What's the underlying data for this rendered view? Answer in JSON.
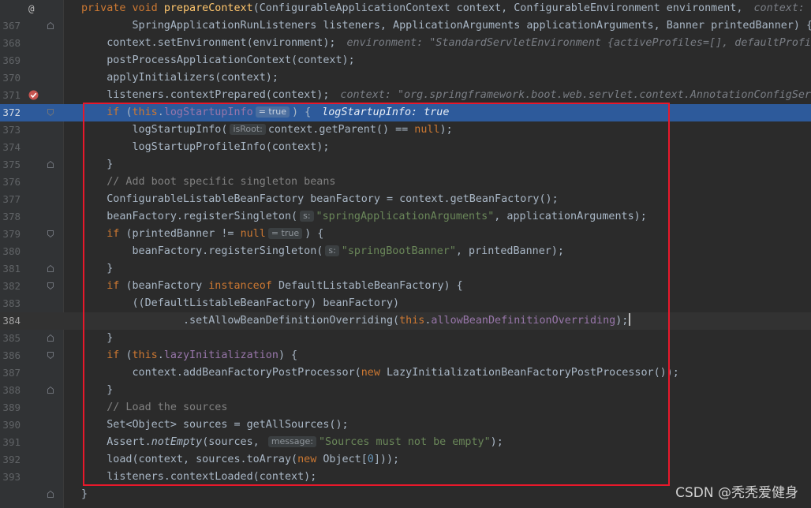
{
  "watermark": "CSDN @秃秃爱健身",
  "colors": {
    "editor_bg": "#2b2b2b",
    "exec_line": "#2d5a9b",
    "breakpoint_line": "#3a2628",
    "annotation_box": "#e8182b",
    "keyword": "#cc7832",
    "method": "#ffc66d",
    "string": "#6a8759",
    "field": "#9876aa"
  },
  "lines": [
    {
      "num": "@",
      "gutter_icon": "override-at-icon",
      "fold": "",
      "tokens": [
        [
          "kw",
          "private void "
        ],
        [
          "fn",
          "prepareContext"
        ],
        [
          "",
          "(ConfigurableApplicationContext context, ConfigurableEnvironment environment,"
        ]
      ],
      "debug": "context: \"or"
    },
    {
      "num": "367",
      "fold": "end",
      "tokens": [
        [
          "",
          "        SpringApplicationRunListeners listeners, ApplicationArguments applicationArguments, Banner printedBanner) {"
        ]
      ],
      "debug": "l"
    },
    {
      "num": "368",
      "tokens": [
        [
          "",
          "    context.setEnvironment(environment);"
        ]
      ],
      "debug": "environment: \"StandardServletEnvironment {activeProfiles=[], defaultProfiles"
    },
    {
      "num": "369",
      "tokens": [
        [
          "",
          "    postProcessApplicationContext(context);"
        ]
      ]
    },
    {
      "num": "370",
      "tokens": [
        [
          "",
          "    applyInitializers(context);"
        ]
      ]
    },
    {
      "num": "371",
      "state": "breakpoint",
      "gutter_icon": "breakpoint-check-icon",
      "tokens": [
        [
          "",
          "    listeners.contextPrepared(context);"
        ]
      ],
      "debug": "context: \"org.springframework.boot.web.servlet.context.AnnotationConfigServle"
    },
    {
      "num": "372",
      "state": "exec",
      "fold": "start",
      "tokens": [
        [
          "",
          "    "
        ],
        [
          "kw",
          "if "
        ],
        [
          "",
          "("
        ],
        [
          "kw",
          "this"
        ],
        [
          "",
          "."
        ],
        [
          "fld",
          "logStartupInfo"
        ],
        [
          "hint",
          "= true"
        ],
        [
          "",
          ") {"
        ]
      ],
      "debug": "logStartupInfo: true"
    },
    {
      "num": "373",
      "tokens": [
        [
          "",
          "        logStartupInfo("
        ],
        [
          "hint",
          "isRoot:"
        ],
        [
          "",
          "context.getParent() == "
        ],
        [
          "kw",
          "null"
        ],
        [
          "",
          ");"
        ]
      ]
    },
    {
      "num": "374",
      "tokens": [
        [
          "",
          "        logStartupProfileInfo(context);"
        ]
      ]
    },
    {
      "num": "375",
      "fold": "end",
      "tokens": [
        [
          "",
          "    }"
        ]
      ]
    },
    {
      "num": "376",
      "tokens": [
        [
          "cm",
          "    // Add boot specific singleton beans"
        ]
      ]
    },
    {
      "num": "377",
      "tokens": [
        [
          "",
          "    ConfigurableListableBeanFactory beanFactory = context.getBeanFactory();"
        ]
      ]
    },
    {
      "num": "378",
      "tokens": [
        [
          "",
          "    beanFactory.registerSingleton("
        ],
        [
          "hint",
          "s:"
        ],
        [
          "str",
          "\"springApplicationArguments\""
        ],
        [
          "",
          ", applicationArguments);"
        ]
      ]
    },
    {
      "num": "379",
      "fold": "start",
      "tokens": [
        [
          "",
          "    "
        ],
        [
          "kw",
          "if "
        ],
        [
          "",
          "(printedBanner != "
        ],
        [
          "kw",
          "null"
        ],
        [
          "hint",
          "= true"
        ],
        [
          "",
          ") {"
        ]
      ]
    },
    {
      "num": "380",
      "tokens": [
        [
          "",
          "        beanFactory.registerSingleton("
        ],
        [
          "hint",
          "s:"
        ],
        [
          "str",
          "\"springBootBanner\""
        ],
        [
          "",
          ", printedBanner);"
        ]
      ]
    },
    {
      "num": "381",
      "fold": "end",
      "tokens": [
        [
          "",
          "    }"
        ]
      ]
    },
    {
      "num": "382",
      "fold": "start",
      "tokens": [
        [
          "",
          "    "
        ],
        [
          "kw",
          "if "
        ],
        [
          "",
          "(beanFactory "
        ],
        [
          "kw",
          "instanceof "
        ],
        [
          "",
          "DefaultListableBeanFactory) {"
        ]
      ]
    },
    {
      "num": "383",
      "tokens": [
        [
          "",
          "        ((DefaultListableBeanFactory) beanFactory)"
        ]
      ]
    },
    {
      "num": "384",
      "state": "current",
      "tokens": [
        [
          "",
          "                .setAllowBeanDefinitionOverriding("
        ],
        [
          "kw",
          "this"
        ],
        [
          "",
          "."
        ],
        [
          "fld",
          "allowBeanDefinitionOverriding"
        ],
        [
          "",
          ");"
        ],
        [
          "caret",
          ""
        ]
      ]
    },
    {
      "num": "385",
      "fold": "end",
      "tokens": [
        [
          "",
          "    }"
        ]
      ]
    },
    {
      "num": "386",
      "fold": "start",
      "tokens": [
        [
          "",
          "    "
        ],
        [
          "kw",
          "if "
        ],
        [
          "",
          "("
        ],
        [
          "kw",
          "this"
        ],
        [
          "",
          "."
        ],
        [
          "fld",
          "lazyInitialization"
        ],
        [
          "",
          ") {"
        ]
      ]
    },
    {
      "num": "387",
      "tokens": [
        [
          "",
          "        context.addBeanFactoryPostProcessor("
        ],
        [
          "kw",
          "new "
        ],
        [
          "",
          "LazyInitializationBeanFactoryPostProcessor());"
        ]
      ]
    },
    {
      "num": "388",
      "fold": "end",
      "tokens": [
        [
          "",
          "    }"
        ]
      ]
    },
    {
      "num": "389",
      "tokens": [
        [
          "cm",
          "    // Load the sources"
        ]
      ]
    },
    {
      "num": "390",
      "tokens": [
        [
          "",
          "    Set<Object> sources = getAllSources();"
        ]
      ]
    },
    {
      "num": "391",
      "tokens": [
        [
          "",
          "    Assert."
        ],
        [
          "it",
          "notEmpty"
        ],
        [
          "",
          "(sources, "
        ],
        [
          "hint",
          "message:"
        ],
        [
          "str",
          "\"Sources must not be empty\""
        ],
        [
          "",
          ");"
        ]
      ]
    },
    {
      "num": "392",
      "tokens": [
        [
          "",
          "    load(context, sources.toArray("
        ],
        [
          "kw",
          "new "
        ],
        [
          "",
          "Object["
        ],
        [
          "num",
          "0"
        ],
        [
          "",
          "]));"
        ]
      ]
    },
    {
      "num": "393",
      "tokens": [
        [
          "",
          "    listeners.contextLoaded(context);"
        ]
      ]
    },
    {
      "num": "",
      "fold": "end",
      "tokens": [
        [
          "",
          "}"
        ]
      ]
    }
  ]
}
